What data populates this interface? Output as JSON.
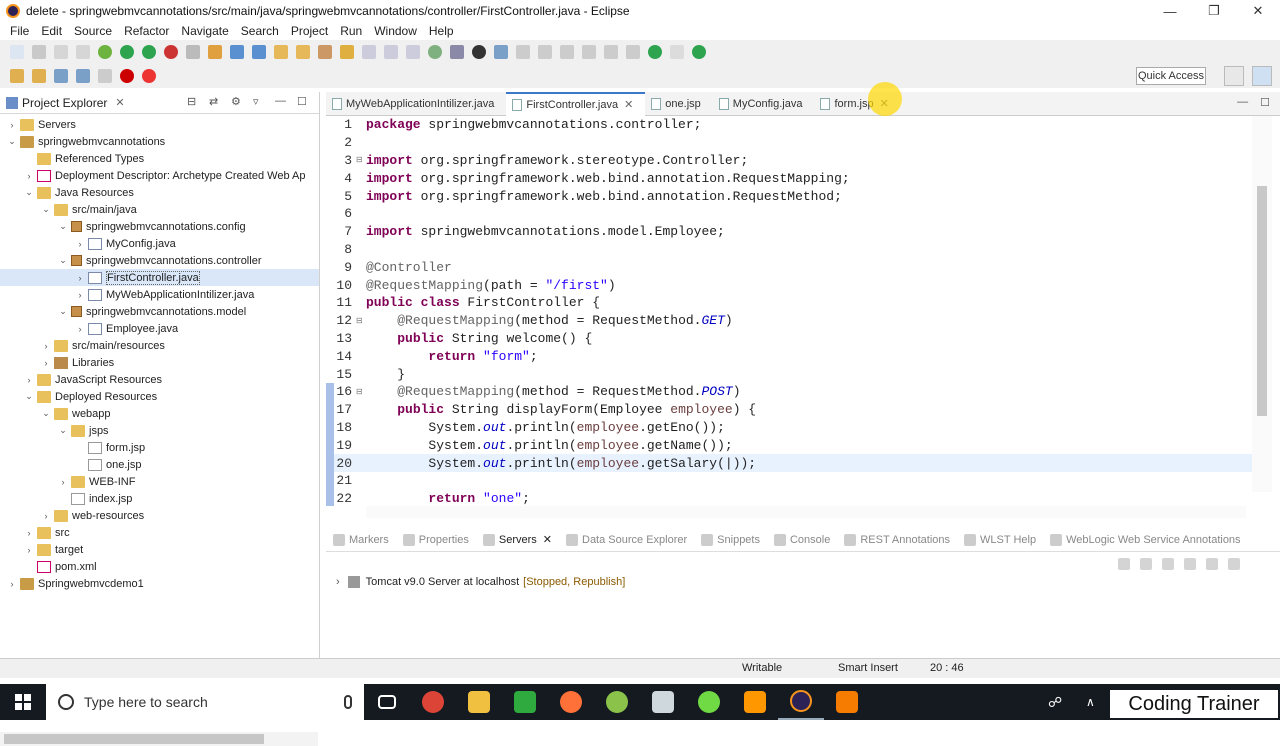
{
  "window": {
    "title": "delete - springwebmvcannotations/src/main/java/springwebmvcannotations/controller/FirstController.java - Eclipse",
    "minimize": "—",
    "restore": "❐",
    "close": "✕"
  },
  "menu": [
    "File",
    "Edit",
    "Source",
    "Refactor",
    "Navigate",
    "Search",
    "Project",
    "Run",
    "Window",
    "Help"
  ],
  "quick_access": "Quick Access",
  "project_explorer": {
    "title": "Project Explorer",
    "tree": [
      {
        "label": "Servers",
        "level": 0,
        "arrow": "›",
        "icon": "folder"
      },
      {
        "label": "springwebmvcannotations",
        "level": 0,
        "arrow": "⌄",
        "icon": "proj"
      },
      {
        "label": "Referenced Types",
        "level": 1,
        "arrow": "",
        "icon": "folder"
      },
      {
        "label": "Deployment Descriptor: Archetype Created Web Ap",
        "level": 1,
        "arrow": "›",
        "icon": "xml"
      },
      {
        "label": "Java Resources",
        "level": 1,
        "arrow": "⌄",
        "icon": "folder"
      },
      {
        "label": "src/main/java",
        "level": 2,
        "arrow": "⌄",
        "icon": "folder"
      },
      {
        "label": "springwebmvcannotations.config",
        "level": 3,
        "arrow": "⌄",
        "icon": "pkg"
      },
      {
        "label": "MyConfig.java",
        "level": 4,
        "arrow": "›",
        "icon": "java"
      },
      {
        "label": "springwebmvcannotations.controller",
        "level": 3,
        "arrow": "⌄",
        "icon": "pkg"
      },
      {
        "label": "FirstController.java",
        "level": 4,
        "arrow": "›",
        "icon": "java",
        "selected": true
      },
      {
        "label": "MyWebApplicationIntilizer.java",
        "level": 4,
        "arrow": "›",
        "icon": "java"
      },
      {
        "label": "springwebmvcannotations.model",
        "level": 3,
        "arrow": "⌄",
        "icon": "pkg"
      },
      {
        "label": "Employee.java",
        "level": 4,
        "arrow": "›",
        "icon": "java"
      },
      {
        "label": "src/main/resources",
        "level": 2,
        "arrow": "›",
        "icon": "folder"
      },
      {
        "label": "Libraries",
        "level": 2,
        "arrow": "›",
        "icon": "lib"
      },
      {
        "label": "JavaScript Resources",
        "level": 1,
        "arrow": "›",
        "icon": "folder"
      },
      {
        "label": "Deployed Resources",
        "level": 1,
        "arrow": "⌄",
        "icon": "folder"
      },
      {
        "label": "webapp",
        "level": 2,
        "arrow": "⌄",
        "icon": "folder"
      },
      {
        "label": "jsps",
        "level": 3,
        "arrow": "⌄",
        "icon": "folder"
      },
      {
        "label": "form.jsp",
        "level": 4,
        "arrow": "",
        "icon": "jsp"
      },
      {
        "label": "one.jsp",
        "level": 4,
        "arrow": "",
        "icon": "jsp"
      },
      {
        "label": "WEB-INF",
        "level": 3,
        "arrow": "›",
        "icon": "folder"
      },
      {
        "label": "index.jsp",
        "level": 3,
        "arrow": "",
        "icon": "jsp"
      },
      {
        "label": "web-resources",
        "level": 2,
        "arrow": "›",
        "icon": "folder"
      },
      {
        "label": "src",
        "level": 1,
        "arrow": "›",
        "icon": "folder"
      },
      {
        "label": "target",
        "level": 1,
        "arrow": "›",
        "icon": "folder"
      },
      {
        "label": "pom.xml",
        "level": 1,
        "arrow": "",
        "icon": "xml"
      },
      {
        "label": "Springwebmvcdemo1",
        "level": 0,
        "arrow": "›",
        "icon": "proj"
      }
    ]
  },
  "editor_tabs": [
    {
      "label": "MyWebApplicationIntilizer.java",
      "active": false
    },
    {
      "label": "FirstController.java",
      "active": true
    },
    {
      "label": "one.jsp",
      "active": false
    },
    {
      "label": "MyConfig.java",
      "active": false
    },
    {
      "label": "form.jsp",
      "active": false
    }
  ],
  "code_lines": [
    {
      "n": "1",
      "html": "<span class='kw'>package</span> springwebmvcannotations.controller;"
    },
    {
      "n": "2",
      "html": ""
    },
    {
      "n": "3",
      "fold": "⊟",
      "html": "<span class='kw'>import</span> org.springframework.stereotype.Controller;"
    },
    {
      "n": "4",
      "html": "<span class='kw'>import</span> org.springframework.web.bind.annotation.RequestMapping;"
    },
    {
      "n": "5",
      "html": "<span class='kw'>import</span> org.springframework.web.bind.annotation.RequestMethod;"
    },
    {
      "n": "6",
      "html": ""
    },
    {
      "n": "7",
      "html": "<span class='kw'>import</span> springwebmvcannotations.model.Employee;"
    },
    {
      "n": "8",
      "html": ""
    },
    {
      "n": "9",
      "html": "<span class='ann'>@Controller</span>"
    },
    {
      "n": "10",
      "html": "<span class='ann'>@RequestMapping</span>(path = <span class='str'>\"/first\"</span>)"
    },
    {
      "n": "11",
      "html": "<span class='kw'>public class</span> FirstController {"
    },
    {
      "n": "12",
      "fold": "⊟",
      "html": "    <span class='ann'>@RequestMapping</span>(method = RequestMethod.<span class='sf'>GET</span>)"
    },
    {
      "n": "13",
      "html": "    <span class='kw'>public</span> String welcome() {"
    },
    {
      "n": "14",
      "html": "        <span class='kw'>return</span> <span class='str'>\"form\"</span>;"
    },
    {
      "n": "15",
      "html": "    }"
    },
    {
      "n": "16",
      "fold": "⊟",
      "html": "    <span class='ann'>@RequestMapping</span>(method = RequestMethod.<span class='sf'>POST</span>)",
      "changed": true
    },
    {
      "n": "17",
      "html": "    <span class='kw'>public</span> String displayForm(Employee <span class='par'>employee</span>) {",
      "changed": true
    },
    {
      "n": "18",
      "html": "        System.<span class='sf'>out</span>.println(<span class='par'>employee</span>.getEno());",
      "changed": true
    },
    {
      "n": "19",
      "html": "        System.<span class='sf'>out</span>.println(<span class='par'>employee</span>.getName());",
      "changed": true
    },
    {
      "n": "20",
      "html": "        System.<span class='sf'>out</span>.println(<span class='par'>employee</span>.getSalary(|));",
      "changed": true,
      "current": true
    },
    {
      "n": "21",
      "html": "",
      "changed": true
    },
    {
      "n": "22",
      "html": "        <span class='kw'>return</span> <span class='str'>\"one\"</span>;",
      "changed": true
    }
  ],
  "bottom_tabs": [
    {
      "label": "Markers",
      "active": false
    },
    {
      "label": "Properties",
      "active": false
    },
    {
      "label": "Servers",
      "active": true
    },
    {
      "label": "Data Source Explorer",
      "active": false
    },
    {
      "label": "Snippets",
      "active": false
    },
    {
      "label": "Console",
      "active": false
    },
    {
      "label": "REST Annotations",
      "active": false
    },
    {
      "label": "WLST Help",
      "active": false
    },
    {
      "label": "WebLogic Web Service Annotations",
      "active": false
    }
  ],
  "server": {
    "name": "Tomcat v9.0 Server at localhost",
    "status": "[Stopped, Republish]"
  },
  "status": {
    "writable": "Writable",
    "insert": "Smart Insert",
    "position": "20 : 46"
  },
  "taskbar": {
    "search_placeholder": "Type here to search"
  },
  "watermark": "Coding Trainer",
  "colors": {
    "keyword": "#7f0055",
    "string": "#2a00ff",
    "annotation": "#646464",
    "accent": "#3c78c8"
  }
}
